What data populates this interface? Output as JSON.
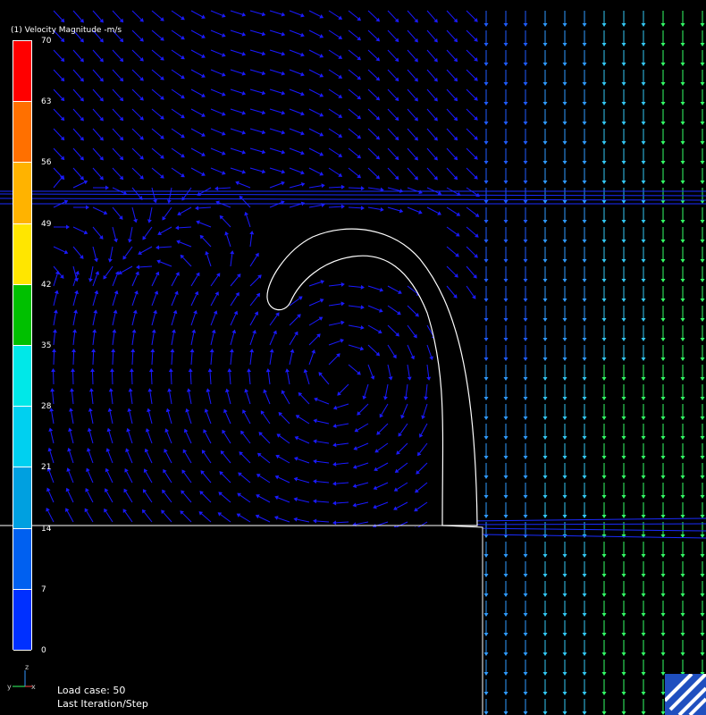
{
  "legend": {
    "title": "(1) Velocity Magnitude -m/s",
    "ticks": [
      "70",
      "63",
      "56",
      "49",
      "42",
      "35",
      "28",
      "21",
      "14",
      "7",
      "0"
    ],
    "colors": [
      "#ff0000",
      "#ff7000",
      "#ffb300",
      "#ffe600",
      "#00c000",
      "#00e8e8",
      "#00d0f0",
      "#00a0e0",
      "#0060f0",
      "#0030ff"
    ]
  },
  "status": {
    "load_case": "Load case: 50",
    "step": "Last Iteration/Step"
  },
  "triad": {
    "z": "z",
    "y": "y",
    "x": "x"
  },
  "palette": {
    "background": "#000000",
    "outline": "#ffffff",
    "vector_low": "#1a1aff",
    "vector_mid": "#3399ff",
    "vector_high": "#33ff66"
  }
}
